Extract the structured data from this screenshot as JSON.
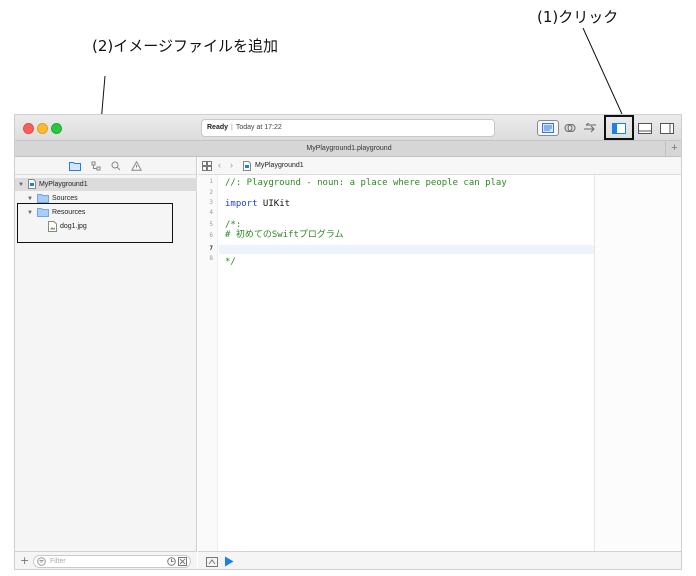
{
  "callouts": {
    "click_label": "(1)クリック",
    "add_image_label": "(2)イメージファイルを追加"
  },
  "window": {
    "status": {
      "state": "Ready",
      "separator": "|",
      "time": "Today at 17:22"
    },
    "tab_title": "MyPlayground1.playground",
    "tab_add": "+"
  },
  "navigator": {
    "tree": [
      {
        "label": "MyPlayground1",
        "kind": "playground"
      },
      {
        "label": "Sources",
        "kind": "folder"
      },
      {
        "label": "Resources",
        "kind": "folder"
      },
      {
        "label": "dog1.jpg",
        "kind": "image-file"
      }
    ],
    "filter_placeholder": "Filter",
    "footer_add": "+"
  },
  "editor": {
    "breadcrumb": "MyPlayground1",
    "line_numbers": [
      "1",
      "2",
      "3",
      "4",
      "5",
      "6",
      "7",
      "8"
    ],
    "lines": {
      "l1": "//: Playground - noun: a place where people can play",
      "l3_kw": "import",
      "l3_rest": " UIKit",
      "l5": "/*:",
      "l6": "# 初めてのSwiftプログラム",
      "l8": "*/"
    }
  },
  "colors": {
    "comment": "#2c8a1f",
    "keyword": "#1f3fd1",
    "accent": "#1a82e6"
  }
}
